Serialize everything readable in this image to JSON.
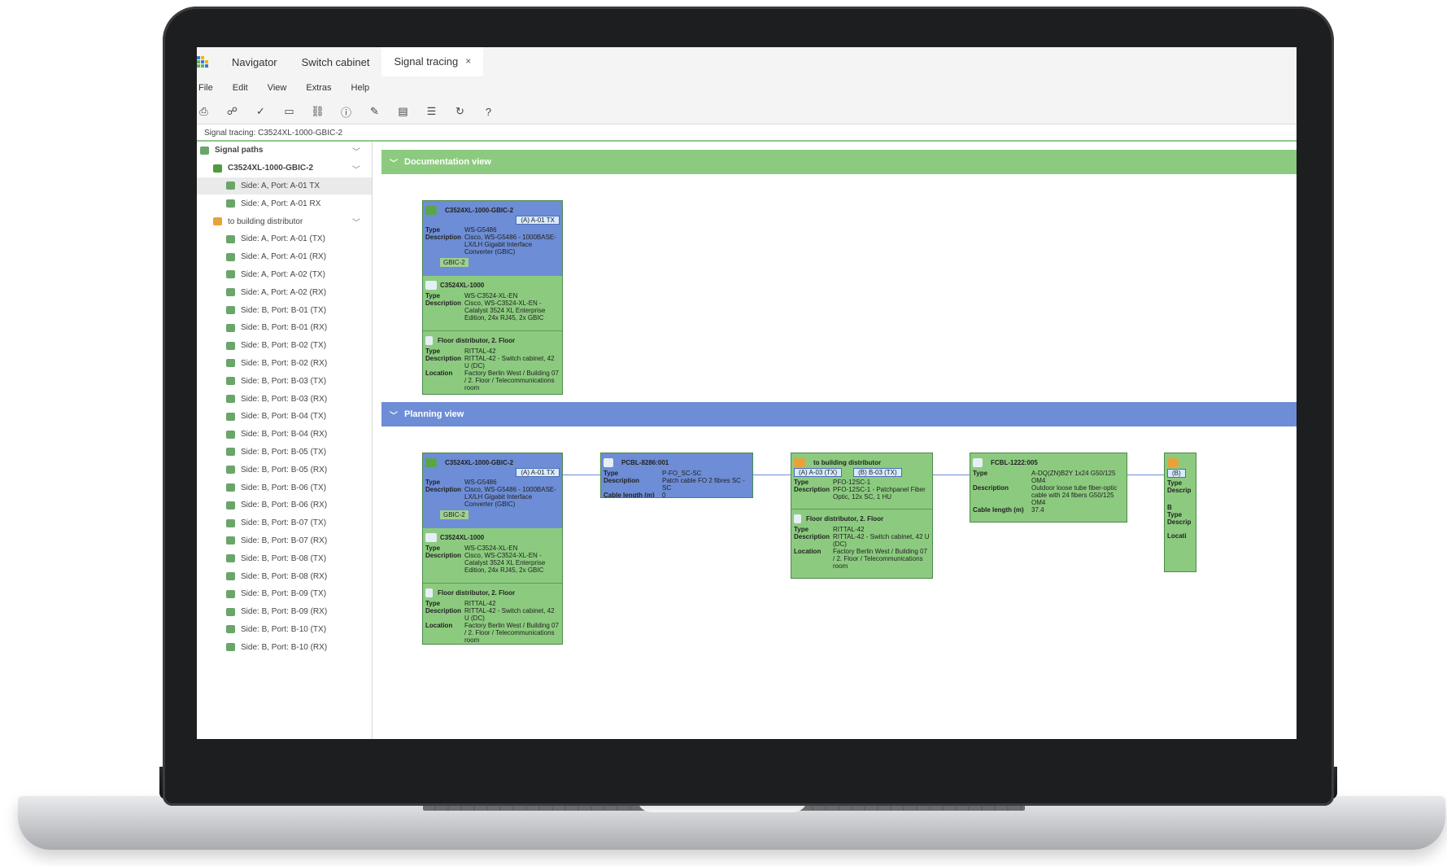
{
  "tabs": [
    {
      "label": "Navigator"
    },
    {
      "label": "Switch cabinet"
    },
    {
      "label": "Signal tracing",
      "close": "×"
    }
  ],
  "menu": [
    "File",
    "Edit",
    "View",
    "Extras",
    "Help"
  ],
  "toolbar_icons": [
    "print-icon",
    "hierarchy-icon",
    "check-circle-icon",
    "comment-icon",
    "link-icon",
    "info-icon",
    "edit-icon",
    "clipboard-icon",
    "list-icon",
    "refresh-icon",
    "help-icon"
  ],
  "breadcrumb": "Signal tracing: C3524XL-1000-GBIC-2",
  "sidebar": {
    "root": "Signal paths",
    "device": "C3524XL-1000-GBIC-2",
    "device_ports": [
      "Side: A, Port: A-01 TX",
      "Side: A, Port: A-01 RX"
    ],
    "distributor": "to building distributor",
    "distributor_ports": [
      "Side: A, Port: A-01 (TX)",
      "Side: A, Port: A-01 (RX)",
      "Side: A, Port: A-02 (TX)",
      "Side: A, Port: A-02 (RX)",
      "Side: B, Port: B-01 (TX)",
      "Side: B, Port: B-01 (RX)",
      "Side: B, Port: B-02 (TX)",
      "Side: B, Port: B-02 (RX)",
      "Side: B, Port: B-03 (TX)",
      "Side: B, Port: B-03 (RX)",
      "Side: B, Port: B-04 (TX)",
      "Side: B, Port: B-04 (RX)",
      "Side: B, Port: B-05 (TX)",
      "Side: B, Port: B-05 (RX)",
      "Side: B, Port: B-06 (TX)",
      "Side: B, Port: B-06 (RX)",
      "Side: B, Port: B-07 (TX)",
      "Side: B, Port: B-07 (RX)",
      "Side: B, Port: B-08 (TX)",
      "Side: B, Port: B-08 (RX)",
      "Side: B, Port: B-09 (TX)",
      "Side: B, Port: B-09 (RX)",
      "Side: B, Port: B-10 (TX)",
      "Side: B, Port: B-10 (RX)"
    ]
  },
  "sections": {
    "documentation": "Documentation view",
    "planning": "Planning view"
  },
  "labels": {
    "type": "Type",
    "description": "Description",
    "location": "Location",
    "cable_length": "Cable length (m)"
  },
  "gbic": {
    "name": "C3524XL-1000-GBIC-2",
    "port": "(A) A-01 TX",
    "type": "WS-G5486",
    "description": "Cisco, WS-G5486 - 1000BASE-LX/LH Gigabit Interface Converter (GBIC)",
    "slot": "GBIC-2"
  },
  "switch": {
    "name": "C3524XL-1000",
    "type": "WS-C3524-XL-EN",
    "description": "Cisco, WS-C3524-XL-EN - Catalyst 3524 XL Enterprise Edition, 24x RJ45, 2x GBIC"
  },
  "floor": {
    "name": "Floor distributor, 2. Floor",
    "type": "RITTAL-42",
    "description": "RITTAL-42 - Switch cabinet, 42 U (DC)",
    "location": "Factory Berlin West / Building 07 / 2. Floor / Telecommunications room"
  },
  "patch": {
    "name": "PCBL-8286:001",
    "type": "P-FO_SC-SC",
    "description": "Patch cable FO 2 fibres SC - SC",
    "cable_length": "0"
  },
  "panel": {
    "name": "to building distributor",
    "port_a": "(A) A-03 (TX)",
    "port_b": "(B) B-03 (TX)",
    "type": "PFO-12SC-1",
    "description": "PFO-12SC-1 - Patchpanel Fiber Optic, 12x SC, 1 HU"
  },
  "fcbl": {
    "name": "FCBL-1222:005",
    "type": "A-DQ(ZN)B2Y 1x24 G50/125 OM4",
    "description": "Outdoor loose tube fiber-optic cable with 24 fibers G50/125 OM4",
    "cable_length": "37.4"
  },
  "partial": {
    "port": "(B)",
    "type": "Type",
    "description": "Descrip",
    "b": "B",
    "location": "Locati"
  },
  "colors": {
    "accent_green": "#8ccb7f",
    "accent_blue": "#6d8dd6",
    "port_blue": "#d9ebff"
  }
}
